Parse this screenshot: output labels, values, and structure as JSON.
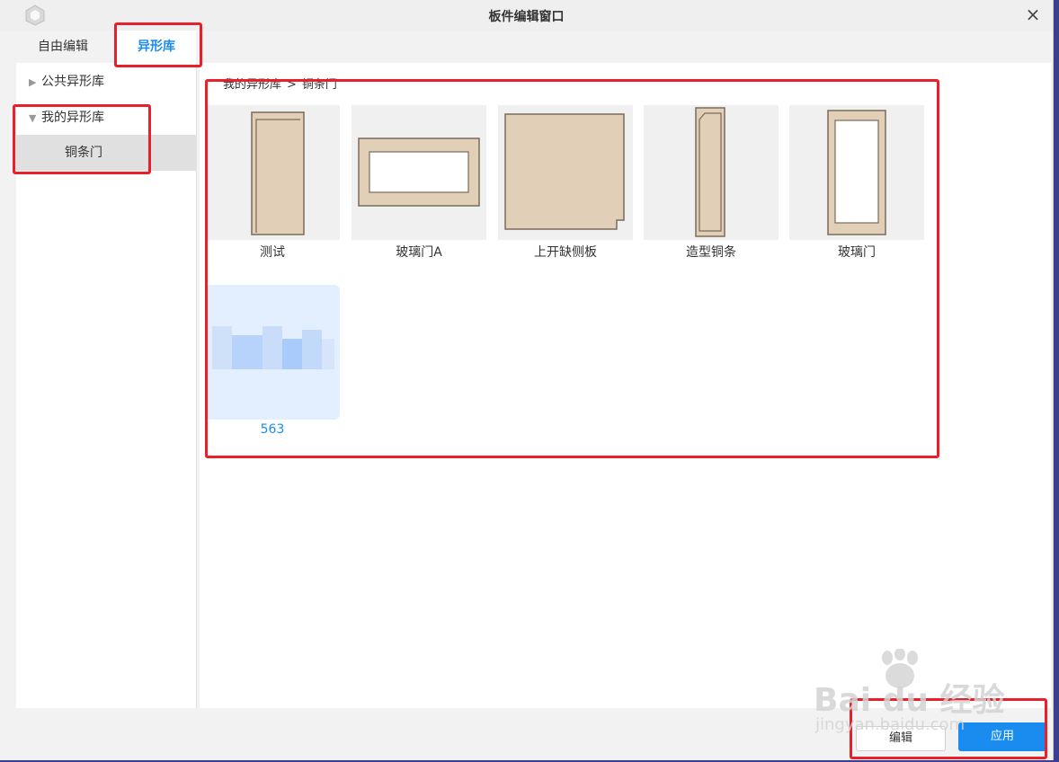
{
  "window": {
    "title": "板件编辑窗口",
    "close_glyph": "×"
  },
  "tabs": [
    {
      "label": "自由编辑",
      "active": false
    },
    {
      "label": "异形库",
      "active": true
    }
  ],
  "sidebar": {
    "public_library": {
      "label": "公共异形库",
      "expanded": false
    },
    "my_library": {
      "label": "我的异形库",
      "expanded": true
    },
    "selected_folder": "铜条门"
  },
  "breadcrumb": {
    "root": "我的异形库",
    "separator": ">",
    "current": "铜条门"
  },
  "items": [
    {
      "label": "测试",
      "icon": "tall-panel-thumbnail"
    },
    {
      "label": "玻璃门A",
      "icon": "glass-door-horizontal-thumbnail"
    },
    {
      "label": "上开缺侧板",
      "icon": "notched-side-panel-thumbnail"
    },
    {
      "label": "造型铜条",
      "icon": "copper-strip-thumbnail"
    },
    {
      "label": "玻璃门",
      "icon": "glass-door-vertical-thumbnail"
    },
    {
      "label": "563",
      "icon": "blurred-thumbnail",
      "selected": true
    }
  ],
  "footer": {
    "edit_label": "编辑",
    "apply_label": "应用"
  },
  "watermark": {
    "brand": "Bai du 经验",
    "site": "jingyan.baidu.com"
  },
  "colors": {
    "accent": "#1a8cf0",
    "highlight": "#e8202a",
    "panel_fill": "#e2cfb8",
    "panel_stroke": "#7a6a5a"
  }
}
